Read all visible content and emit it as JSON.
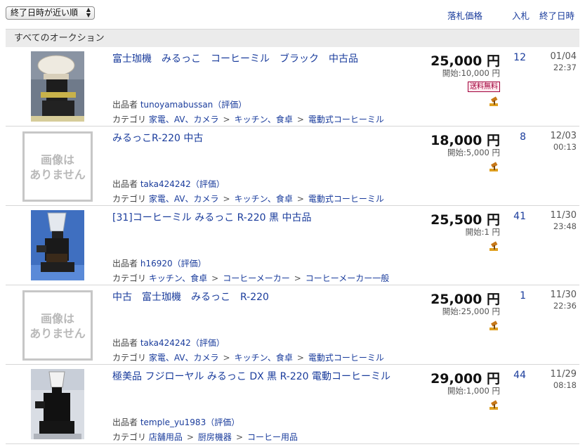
{
  "toolbar": {
    "sort_label": "終了日時が近い順"
  },
  "columns": {
    "price": "落札価格",
    "bids": "入札",
    "end": "終了日時"
  },
  "section_title": "すべてのオークション",
  "labels": {
    "seller": "出品者",
    "rating": "（評価）",
    "category": "カテゴリ",
    "start_prefix": "開始:",
    "sep": ">"
  },
  "no_image": {
    "line1": "画像は",
    "line2": "ありません"
  },
  "colors": {
    "link": "#1a3c9c",
    "section_bg": "#ebebeb",
    "free_ship_border": "#a0003a"
  },
  "items": [
    {
      "title": "富士珈機　みるっこ　コーヒーミル　ブラック　中古品",
      "price": "25,000 円",
      "start": "開始:10,000 円",
      "free_shipping": "送料無料",
      "bids": "12",
      "date": "01/04",
      "time": "22:37",
      "seller": "tunoyamabussan",
      "categories": [
        "家電、AV、カメラ",
        "キッチン、食卓",
        "電動式コーヒーミル"
      ]
    },
    {
      "title": "みるっこR-220 中古",
      "price": "18,000 円",
      "start": "開始:5,000 円",
      "bids": "8",
      "date": "12/03",
      "time": "00:13",
      "seller": "taka424242",
      "categories": [
        "家電、AV、カメラ",
        "キッチン、食卓",
        "電動式コーヒーミル"
      ]
    },
    {
      "title": "[31]コーヒーミル みるっこ R-220 黒 中古品",
      "price": "25,500 円",
      "start": "開始:1 円",
      "bids": "41",
      "date": "11/30",
      "time": "23:48",
      "seller": "h16920",
      "categories": [
        "キッチン、食卓",
        "コーヒーメーカー",
        "コーヒーメーカー一般"
      ]
    },
    {
      "title": "中古　富士珈機　みるっこ　R-220",
      "price": "25,000 円",
      "start": "開始:25,000 円",
      "bids": "1",
      "date": "11/30",
      "time": "22:36",
      "seller": "taka424242",
      "categories": [
        "家電、AV、カメラ",
        "キッチン、食卓",
        "電動式コーヒーミル"
      ]
    },
    {
      "title": "極美品 フジローヤル みるっこ DX 黒 R-220 電動コーヒーミル",
      "price": "29,000 円",
      "start": "開始:1,000 円",
      "bids": "44",
      "date": "11/29",
      "time": "08:18",
      "seller": "temple_yu1983",
      "categories": [
        "店舗用品",
        "厨房機器",
        "コーヒー用品"
      ]
    }
  ]
}
